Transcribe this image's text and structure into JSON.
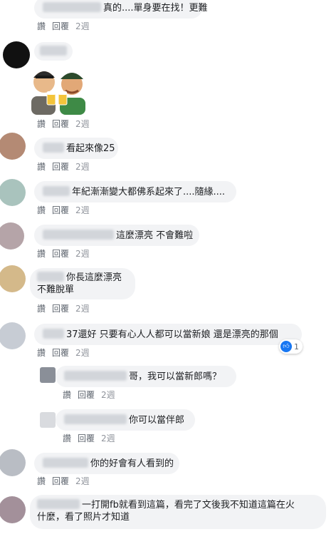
{
  "actions": {
    "like": "讚",
    "reply": "回覆",
    "time": "2週"
  },
  "comments": [
    {
      "text": "真的....單身要在找！更難"
    },
    {
      "text": ""
    },
    {
      "text": "看起來像25"
    },
    {
      "text": "年紀漸漸變大都佛系起來了....隨緣...."
    },
    {
      "text": "這麼漂亮 不會難啦"
    },
    {
      "line1": "你長這麼漂亮",
      "line2": "不難脫單"
    },
    {
      "text": "37還好 只要有心人人都可以當新娘 還是漂亮的那個",
      "reaction_count": "1"
    },
    {
      "text": "哥，我可以當新郎嗎？"
    },
    {
      "text": "你可以當伴郎"
    },
    {
      "text": "你的好會有人看到的"
    },
    {
      "line1": "一打開fb就看到這篇，看完了文後我不知道這篇在火",
      "line2": "什麼，看了照片才知道"
    }
  ],
  "colors": {
    "bubble": "#f2f3f5",
    "like_blue": "#1877f2",
    "meta_text": "#606770"
  },
  "icons": {
    "sticker": "cheers-beer-sticker",
    "reaction": "like-icon"
  }
}
